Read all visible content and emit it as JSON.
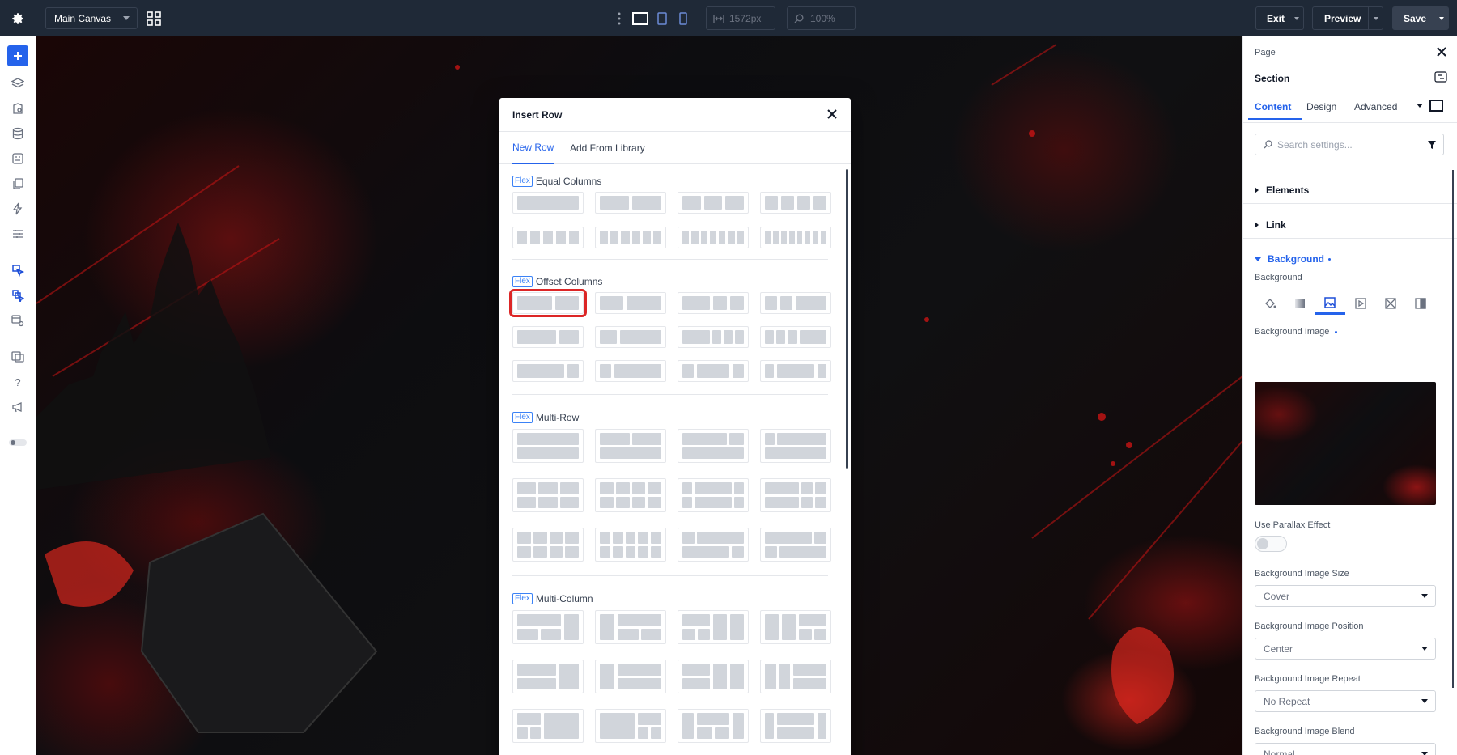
{
  "topbar": {
    "canvas_select": "Main Canvas",
    "width_value": "1572px",
    "zoom_value": "100%",
    "exit_label": "Exit",
    "preview_label": "Preview",
    "save_label": "Save"
  },
  "colors": {
    "accent": "#2563eb",
    "topbar": "#1f2937",
    "highlight": "#dc2626"
  },
  "modal": {
    "title": "Insert Row",
    "tabs": [
      "New Row",
      "Add From Library"
    ],
    "flex_tag": "Flex",
    "sections": {
      "equal": "Equal Columns",
      "offset": "Offset Columns",
      "multirow": "Multi-Row",
      "multicol": "Multi-Column"
    }
  },
  "panel": {
    "breadcrumb": "Page",
    "title": "Section",
    "tabs": [
      "Content",
      "Design",
      "Advanced"
    ],
    "search_placeholder": "Search settings...",
    "accordions": [
      "Elements",
      "Link",
      "Background"
    ],
    "background_label": "Background",
    "background_image_label": "Background Image",
    "parallax_label": "Use Parallax Effect",
    "size_label": "Background Image Size",
    "size_value": "Cover",
    "position_label": "Background Image Position",
    "position_value": "Center",
    "repeat_label": "Background Image Repeat",
    "repeat_value": "No Repeat",
    "blend_label": "Background Image Blend",
    "blend_value": "Normal"
  }
}
